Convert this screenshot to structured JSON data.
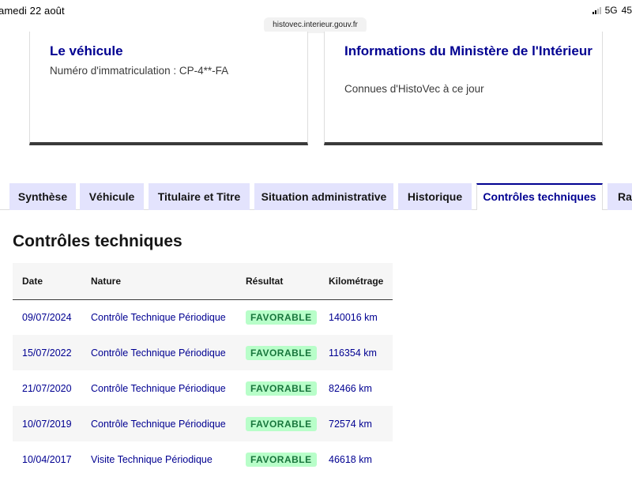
{
  "status_bar": {
    "date": "amedi 22 août",
    "url": "histovec.interieur.gouv.fr",
    "network": "5G",
    "battery": "45"
  },
  "cards": [
    {
      "title": "Le véhicule",
      "description": "Numéro d'immatriculation : CP-4**-FA"
    },
    {
      "title": "Informations du Ministère de l'Intérieur",
      "description": "Connues d'HistoVec à ce jour"
    }
  ],
  "tabs": [
    {
      "label": "Synthèse"
    },
    {
      "label": "Véhicule"
    },
    {
      "label": "Titulaire et Titre"
    },
    {
      "label": "Situation administrative"
    },
    {
      "label": "Historique"
    },
    {
      "label": "Contrôles techniques",
      "active": true
    },
    {
      "label": "Rap"
    }
  ],
  "section": {
    "title": "Contrôles techniques"
  },
  "table": {
    "headers": [
      "Date",
      "Nature",
      "Résultat",
      "Kilométrage"
    ],
    "rows": [
      {
        "date": "09/07/2024",
        "nature": "Contrôle Technique Périodique",
        "result": "FAVORABLE",
        "km": "140016 km"
      },
      {
        "date": "15/07/2022",
        "nature": "Contrôle Technique Périodique",
        "result": "FAVORABLE",
        "km": "116354 km"
      },
      {
        "date": "21/07/2020",
        "nature": "Contrôle Technique Périodique",
        "result": "FAVORABLE",
        "km": "82466 km"
      },
      {
        "date": "10/07/2019",
        "nature": "Contrôle Technique Périodique",
        "result": "FAVORABLE",
        "km": "72574 km"
      },
      {
        "date": "10/04/2017",
        "nature": "Visite Technique Périodique",
        "result": "FAVORABLE",
        "km": "46618 km"
      }
    ]
  },
  "colors": {
    "primary": "#000091",
    "tab_bg": "#e3e3fd",
    "badge_bg": "#b8fec9",
    "badge_text": "#18753c"
  }
}
